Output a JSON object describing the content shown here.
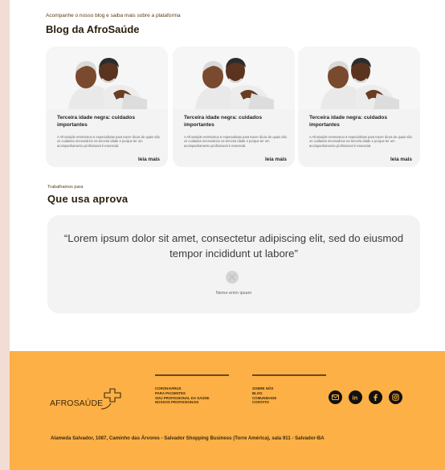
{
  "blog": {
    "subtitle": "Acompanhe o nosso blog e saiba mais sobre a plataforma",
    "title": "Blog da AfroSaúde",
    "cards": [
      {
        "title": "Terceira idade negra: cuidados importantes",
        "text": "A AfroSaúde entrevistou 6 especialistas para trazer dicas de quais são os cuidados necessários na terceira idade e porque ter um acompanhamento profissional é essencial.",
        "link": "leia mais"
      },
      {
        "title": "Terceira idade negra: cuidados importantes",
        "text": "A AfroSaúde entrevistou 6 especialistas para trazer dicas de quais são os cuidados necessários na terceira idade e porque ter um acompanhamento profissional é essencial.",
        "link": "leia mais"
      },
      {
        "title": "Terceira idade negra: cuidados importantes",
        "text": "A AfroSaúde entrevistou 6 especialistas para trazer dicas de quais são os cuidados necessários na terceira idade e porque ter um acompanhamento profissional é essencial.",
        "link": "leia mais"
      }
    ]
  },
  "testimonials": {
    "subtitle": "Trabalhamos para",
    "title": "Que usa aprova",
    "quote": "“Lorem ipsum dolor sit amet, consectetur adipiscing elit, sed do eiusmod tempor incididunt ut labore”",
    "author": "Nemo enim ipsam"
  },
  "footer": {
    "logo_text": "AFROSAÚDE",
    "links_col1": [
      "CORONAVÍRUS",
      "PARA PACIENTES",
      "SOU PROFISSIONAL DA SAÚDE",
      "NOSSOS PROFISSIONAIS"
    ],
    "links_col2": [
      "SOBRE NÓS",
      "BLOG",
      "COMUNIDADE",
      "CONTATO"
    ],
    "social_icons": [
      "email-icon",
      "linkedin-icon",
      "facebook-icon",
      "instagram-icon"
    ],
    "address": "Alameda Salvador, 1087, Caminho das Árvores - Salvador Shopping Business (Torre América), sala 911 - Salvador-BA"
  },
  "colors": {
    "footer": "#fcb045",
    "background": "#f1ddd3",
    "card": "#f3f3f3"
  }
}
